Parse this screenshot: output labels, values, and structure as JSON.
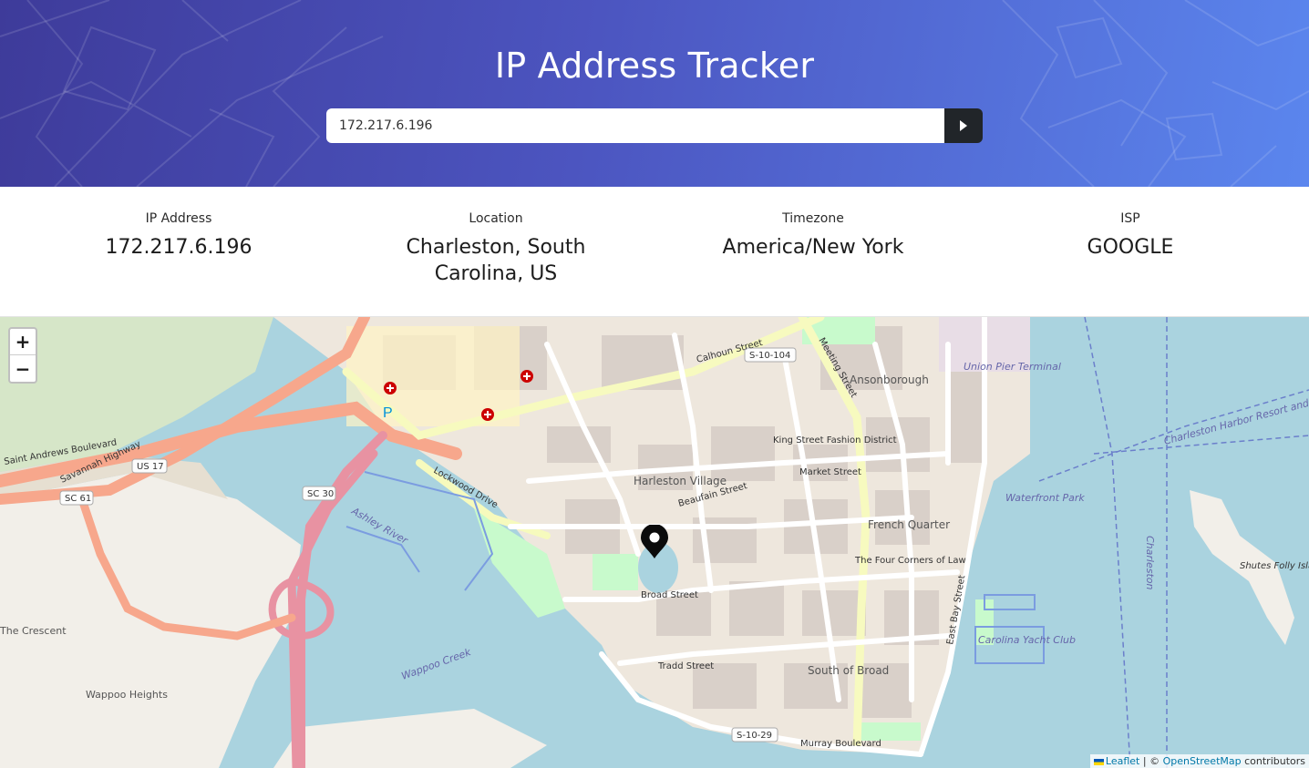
{
  "app": {
    "title": "IP Address Tracker"
  },
  "search": {
    "value": "172.217.6.196",
    "submit_icon": "caret-right-icon"
  },
  "info": {
    "ip_label": "IP Address",
    "ip_value": "172.217.6.196",
    "location_label": "Location",
    "location_value": "Charleston, South Carolina, US",
    "timezone_label": "Timezone",
    "timezone_value": "America/New York",
    "isp_label": "ISP",
    "isp_value": "GOOGLE"
  },
  "map": {
    "zoom_in": "+",
    "zoom_out": "−",
    "marker_icon": "map-pin-icon",
    "attribution": {
      "leaflet": "Leaflet",
      "separator": " | © ",
      "osm": "OpenStreetMap",
      "suffix": " contributors"
    },
    "labels": {
      "harleston": "Harleston Village",
      "ansonborough": "Ansonborough",
      "french_quarter": "French Quarter",
      "south_of_broad": "South of Broad",
      "king_street": "King Street Fashion District",
      "four_corners": "The Four Corners of Law",
      "union_pier": "Union Pier Terminal",
      "waterfront_park": "Waterfront Park",
      "carolina_yacht": "Carolina Yacht Club",
      "ashley_river": "Ashley River",
      "wappoo_creek": "Wappoo Creek",
      "wappoo_heights": "Wappoo Heights",
      "the_crescent": "The Crescent",
      "shutes": "Shutes Folly Island",
      "broad_street": "Broad Street",
      "calhoun_street": "Calhoun Street",
      "meeting_street": "Meeting Street",
      "king_st": "King Street",
      "murray": "Murray Boulevard",
      "savannah": "Savannah Highway",
      "st_andrews": "Saint Andrews Boulevard",
      "us17": "US 17",
      "sc61": "SC 61",
      "sc30": "SC 30",
      "s10104": "S-10-104",
      "s1029": "S-10-29",
      "market_street": "Market Street",
      "beaufain": "Beaufain Street",
      "lockwood": "Lockwood Drive",
      "tradd": "Tradd Street",
      "east_bay": "East Bay Street",
      "charleston": "Charleston",
      "harbor_resort": "Charleston Harbor Resort and Marina"
    }
  }
}
